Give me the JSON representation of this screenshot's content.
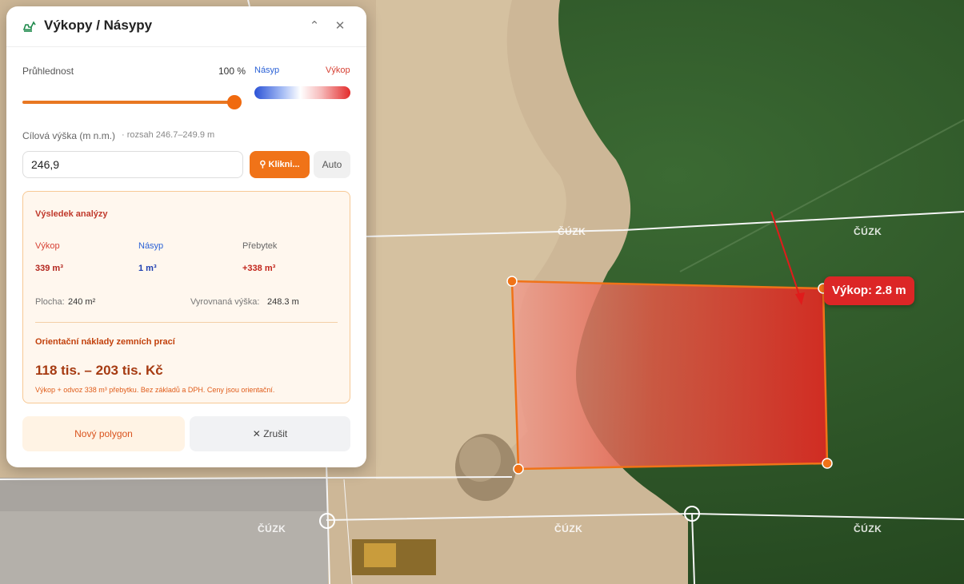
{
  "panel": {
    "title": "Výkopy / Násypy",
    "collapse_icon": "chevron-up-icon",
    "close_icon": "close-icon",
    "title_icon": "excavator-icon"
  },
  "opacity": {
    "label": "Průhlednost",
    "value_text": "100 %",
    "value": 1.0
  },
  "legend": {
    "fill_label": "Násyp",
    "cut_label": "Výkop",
    "fill_color": "#2b52d6",
    "cut_color": "#e32b2b"
  },
  "target_height": {
    "label": "Cílová výška (m n.m.)",
    "range": "· rozsah 246.7–249.9 m",
    "value": "246,9",
    "click_button": "Klikni...",
    "click_icon": "map-pin-icon",
    "auto_button": "Auto"
  },
  "result": {
    "title": "Výsledek analýzy",
    "cut_label": "Výkop",
    "cut_value": "339 m³",
    "fill_label": "Násyp",
    "fill_value": "1 m³",
    "surplus_label": "Přebytek",
    "surplus_value": "+338 m³",
    "area_label": "Plocha:",
    "area_value": "240 m²",
    "level_label": "Vyrovnaná výška:",
    "level_value": "248.3 m",
    "cost_title": "Orientační náklady zemních prací",
    "cost_value": "118 tis. – 203 tis. Kč",
    "cost_note": "Výkop + odvoz 338 m³ přebytku. Bez základů a DPH. Ceny jsou orientační."
  },
  "actions": {
    "new_polygon": "Nový polygon",
    "cancel": "Zrušit",
    "cancel_icon": "close-icon"
  },
  "map": {
    "depth_label": "Výkop: 2.8 m",
    "watermark": "ČÚZK",
    "accent": "#f07318"
  }
}
